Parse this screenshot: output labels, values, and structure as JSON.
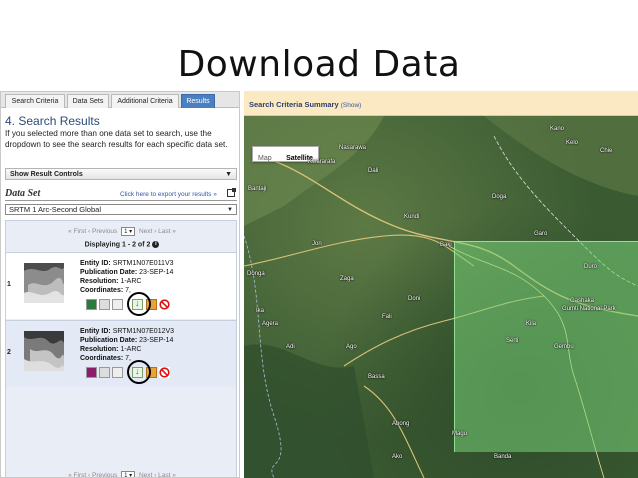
{
  "slide": {
    "title": "Download Data"
  },
  "tabs": [
    {
      "label": "Search Criteria"
    },
    {
      "label": "Data Sets"
    },
    {
      "label": "Additional Criteria"
    },
    {
      "label": "Results",
      "active": true
    }
  ],
  "results": {
    "heading": "4. Search Results",
    "help": "If you selected more than one data set to search, use the dropdown to see the search results for each specific data set.",
    "show_controls": "Show Result Controls",
    "dataset_label": "Data Set",
    "export_link": "Click here to export your results »",
    "dataset_selected": "SRTM 1 Arc-Second Global",
    "pager": {
      "first": "« First",
      "previous": "‹ Previous",
      "page": "1",
      "next": "Next ›",
      "last": "Last »"
    },
    "displaying": "Displaying 1 - 2 of 2",
    "rows": [
      {
        "num": "1",
        "entity_label": "Entity ID:",
        "entity": "SRTM1N07E011V3",
        "pub_label": "Publication Date:",
        "pub": "23-SEP-14",
        "res_label": "Resolution:",
        "res": "1-ARC",
        "coord_label": "Coordinates:",
        "coord": "7,"
      },
      {
        "num": "2",
        "entity_label": "Entity ID:",
        "entity": "SRTM1N07E012V3",
        "pub_label": "Publication Date:",
        "pub": "23-SEP-14",
        "res_label": "Resolution:",
        "res": "1-ARC",
        "coord_label": "Coordinates:",
        "coord": "7,"
      }
    ]
  },
  "map": {
    "criteria_title": "Search Criteria Summary",
    "criteria_show": "(Show)",
    "type_map": "Map",
    "type_satellite": "Satellite",
    "places": [
      {
        "name": "Kano"
      },
      {
        "name": "Nasarawa"
      },
      {
        "name": "Kwararafa"
      },
      {
        "name": "Dali"
      },
      {
        "name": "Kelo"
      },
      {
        "name": "Chie"
      },
      {
        "name": "Bantaji"
      },
      {
        "name": "Jon"
      },
      {
        "name": "Doga"
      },
      {
        "name": "Kundi"
      },
      {
        "name": "Baki"
      },
      {
        "name": "Garo"
      },
      {
        "name": "Duro"
      },
      {
        "name": "Donga"
      },
      {
        "name": "Zaga"
      },
      {
        "name": "Doni"
      },
      {
        "name": "Ika"
      },
      {
        "name": "Agera"
      },
      {
        "name": "Fali"
      },
      {
        "name": "Adi"
      },
      {
        "name": "Ago"
      },
      {
        "name": "Bassa"
      },
      {
        "name": "Abong"
      },
      {
        "name": "Magu"
      },
      {
        "name": "Ako"
      },
      {
        "name": "Banda"
      },
      {
        "name": "Gashaka"
      },
      {
        "name": "Gumti National Park"
      },
      {
        "name": "Serti"
      },
      {
        "name": "Kila"
      },
      {
        "name": "Gembu"
      }
    ]
  },
  "colors": {
    "tab_active": "#4a7fc1",
    "criteria_bar": "#fbe9c3",
    "overlay": "#78d278",
    "highlight_circle": "#000000"
  }
}
